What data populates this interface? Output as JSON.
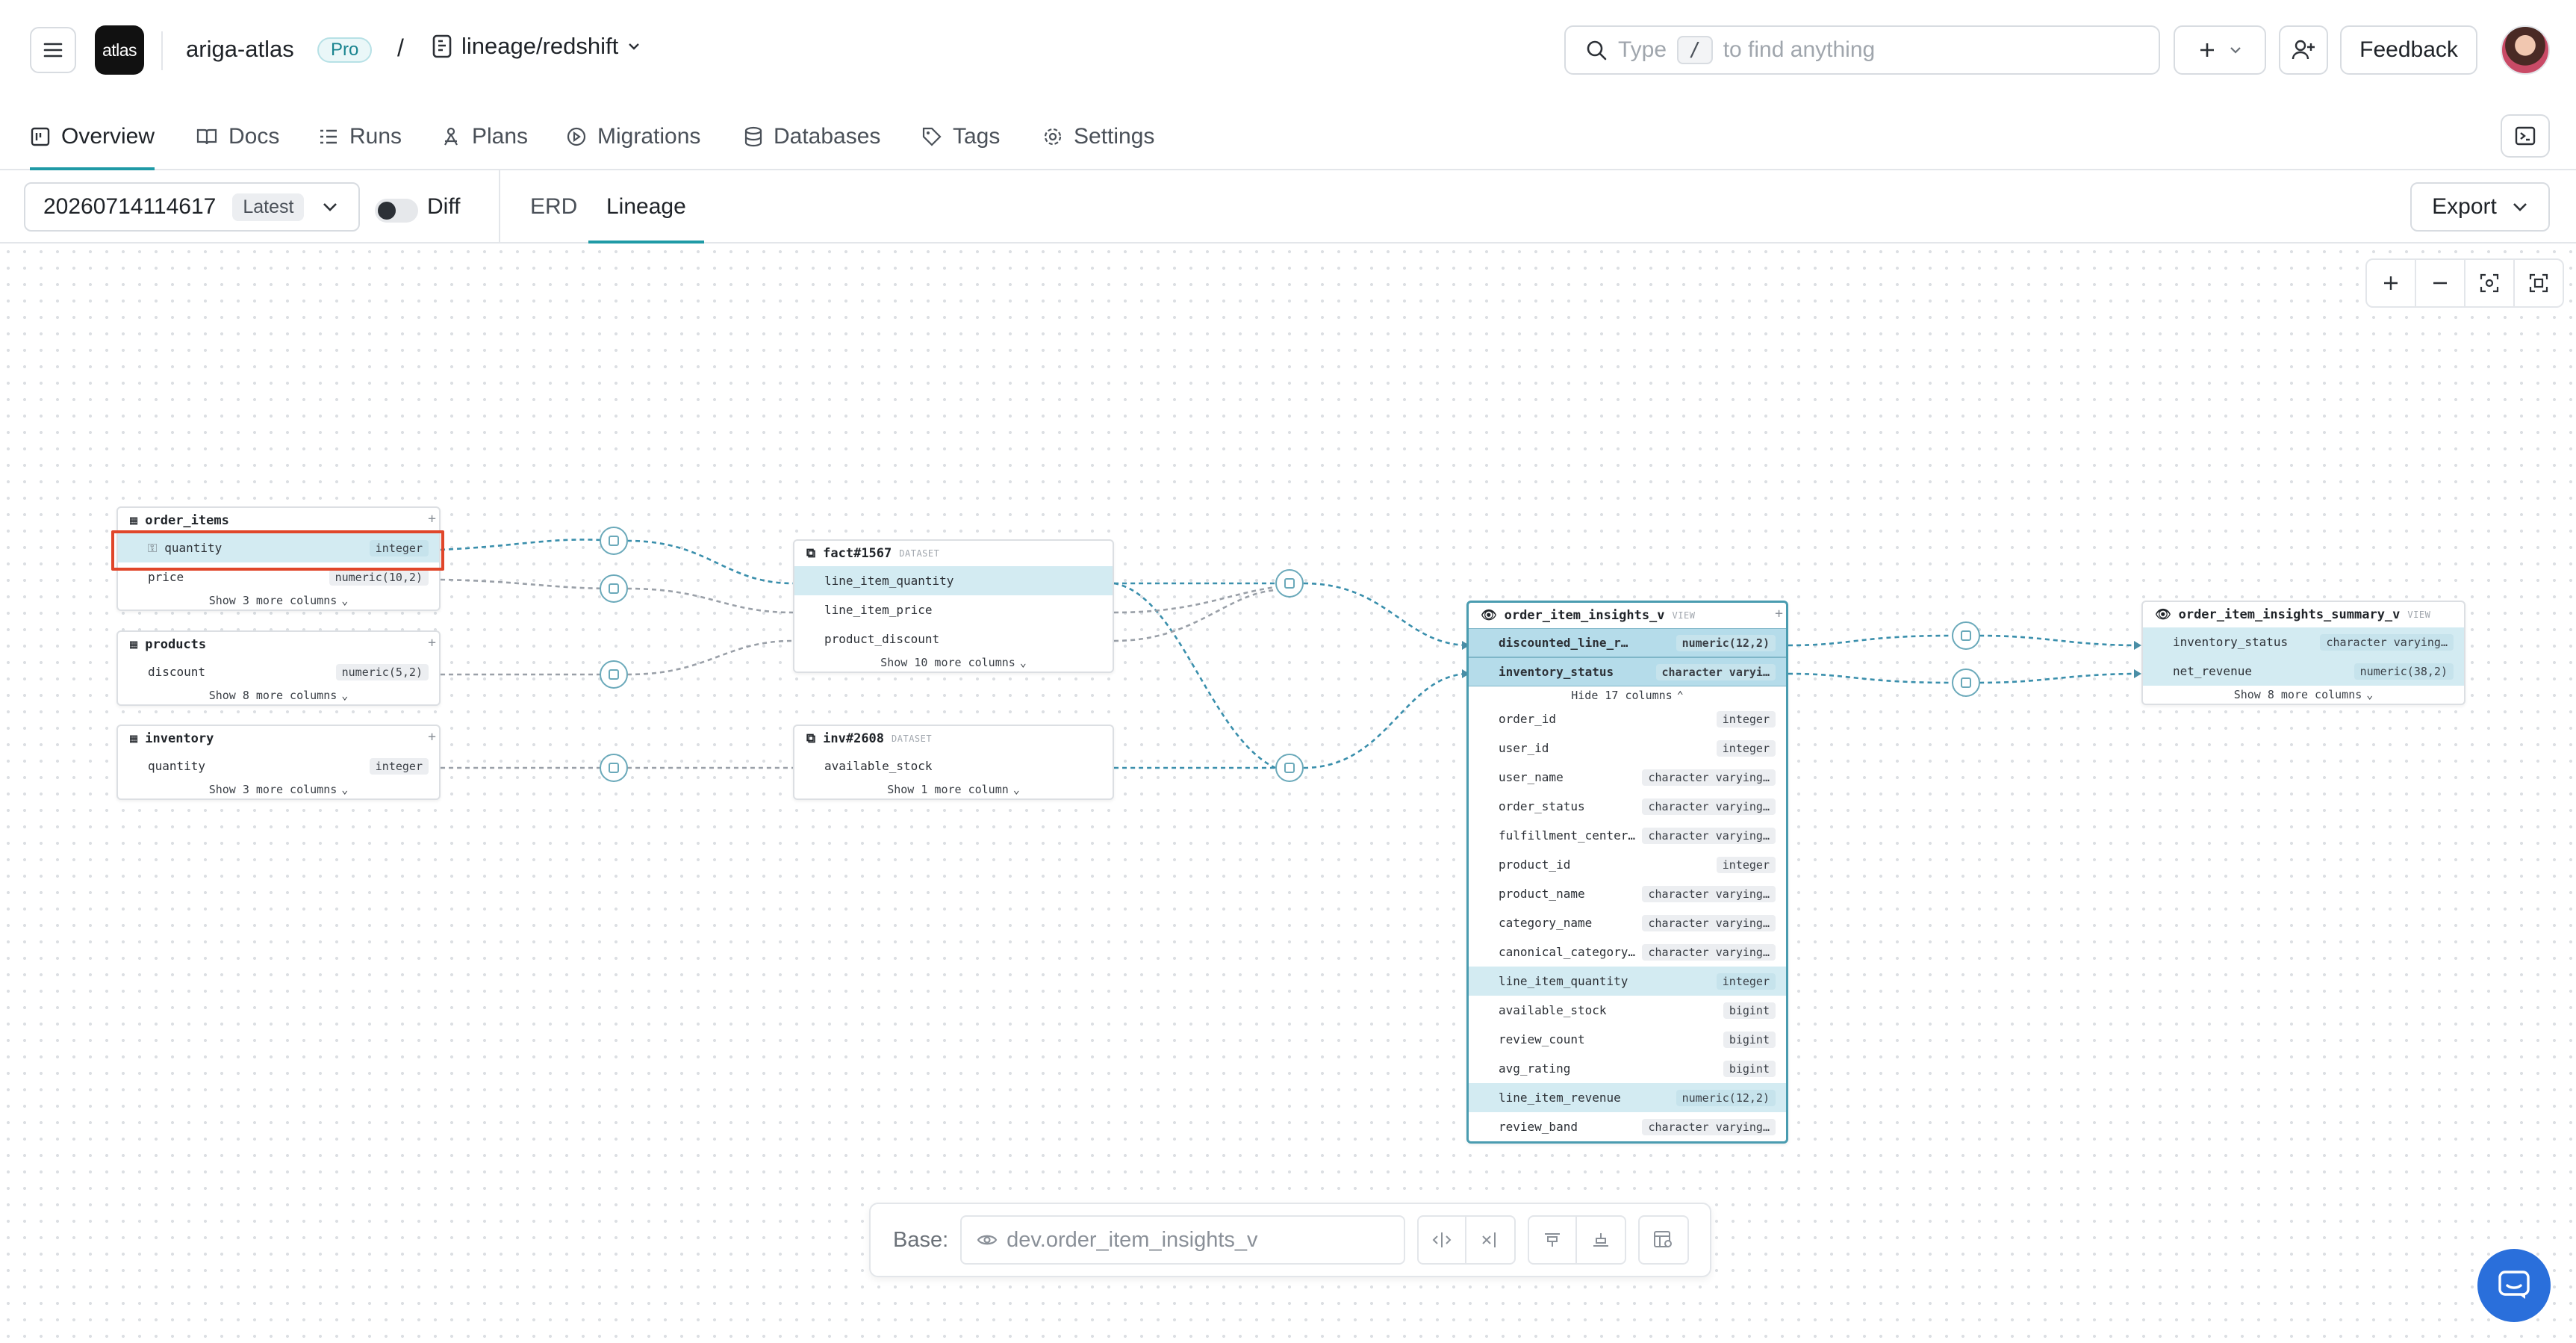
{
  "header": {
    "logo_text": "atlas",
    "org_name": "ariga-atlas",
    "plan_badge": "Pro",
    "separator": "/",
    "repo_name": "lineage/redshift",
    "search_placeholder_pre": "Type",
    "search_key": "/",
    "search_placeholder_post": "to find anything",
    "feedback_label": "Feedback"
  },
  "nav": {
    "tabs": [
      {
        "label": "Overview",
        "icon": "overview-icon",
        "active": true
      },
      {
        "label": "Docs",
        "icon": "docs-icon"
      },
      {
        "label": "Runs",
        "icon": "runs-icon"
      },
      {
        "label": "Plans",
        "icon": "plans-icon"
      },
      {
        "label": "Migrations",
        "icon": "migrations-icon"
      },
      {
        "label": "Databases",
        "icon": "databases-icon"
      },
      {
        "label": "Tags",
        "icon": "tags-icon"
      },
      {
        "label": "Settings",
        "icon": "settings-icon"
      }
    ]
  },
  "toolbar": {
    "version": "20260714114617",
    "latest_badge": "Latest",
    "diff_label": "Diff",
    "erd_tab": "ERD",
    "lineage_tab": "Lineage",
    "export_label": "Export"
  },
  "graph": {
    "order_items": {
      "name": "order_items",
      "rows": [
        {
          "name": "quantity",
          "type": "integer"
        },
        {
          "name": "price",
          "type": "numeric(10,2)"
        }
      ],
      "more": "Show 3 more columns"
    },
    "products": {
      "name": "products",
      "rows": [
        {
          "name": "discount",
          "type": "numeric(5,2)"
        }
      ],
      "more": "Show 8 more columns"
    },
    "inventory": {
      "name": "inventory",
      "rows": [
        {
          "name": "quantity",
          "type": "integer"
        }
      ],
      "more": "Show 3 more columns"
    },
    "fact": {
      "name": "fact#1567",
      "tag": "DATASET",
      "rows": [
        {
          "name": "line_item_quantity"
        },
        {
          "name": "line_item_price"
        },
        {
          "name": "product_discount"
        }
      ],
      "more": "Show 10 more columns"
    },
    "inv": {
      "name": "inv#2608",
      "tag": "DATASET",
      "rows": [
        {
          "name": "available_stock"
        }
      ],
      "more": "Show 1 more column"
    },
    "insights": {
      "name": "order_item_insights_v",
      "tag": "VIEW",
      "rows": [
        {
          "name": "discounted_line_r…",
          "type": "numeric(12,2)"
        },
        {
          "name": "inventory_status",
          "type": "character varyi…"
        }
      ],
      "hide": "Hide 17 columns",
      "extra_rows": [
        {
          "name": "order_id",
          "type": "integer"
        },
        {
          "name": "user_id",
          "type": "integer"
        },
        {
          "name": "user_name",
          "type": "character varying…"
        },
        {
          "name": "order_status",
          "type": "character varying…"
        },
        {
          "name": "fulfillment_center…",
          "type": "character varying…"
        },
        {
          "name": "product_id",
          "type": "integer"
        },
        {
          "name": "product_name",
          "type": "character varying…"
        },
        {
          "name": "category_name",
          "type": "character varying…"
        },
        {
          "name": "canonical_category…",
          "type": "character varying…"
        },
        {
          "name": "line_item_quantity",
          "type": "integer"
        },
        {
          "name": "available_stock",
          "type": "bigint"
        },
        {
          "name": "review_count",
          "type": "bigint"
        },
        {
          "name": "avg_rating",
          "type": "bigint"
        },
        {
          "name": "line_item_revenue",
          "type": "numeric(12,2)"
        },
        {
          "name": "review_band",
          "type": "character varying…"
        }
      ]
    },
    "summary": {
      "name": "order_item_insights_summary_v",
      "tag": "VIEW",
      "rows": [
        {
          "name": "inventory_status",
          "type": "character varying…"
        },
        {
          "name": "net_revenue",
          "type": "numeric(38,2)"
        }
      ],
      "more": "Show 8 more columns"
    }
  },
  "basebar": {
    "label": "Base:",
    "placeholder": "dev.order_item_insights_v"
  }
}
